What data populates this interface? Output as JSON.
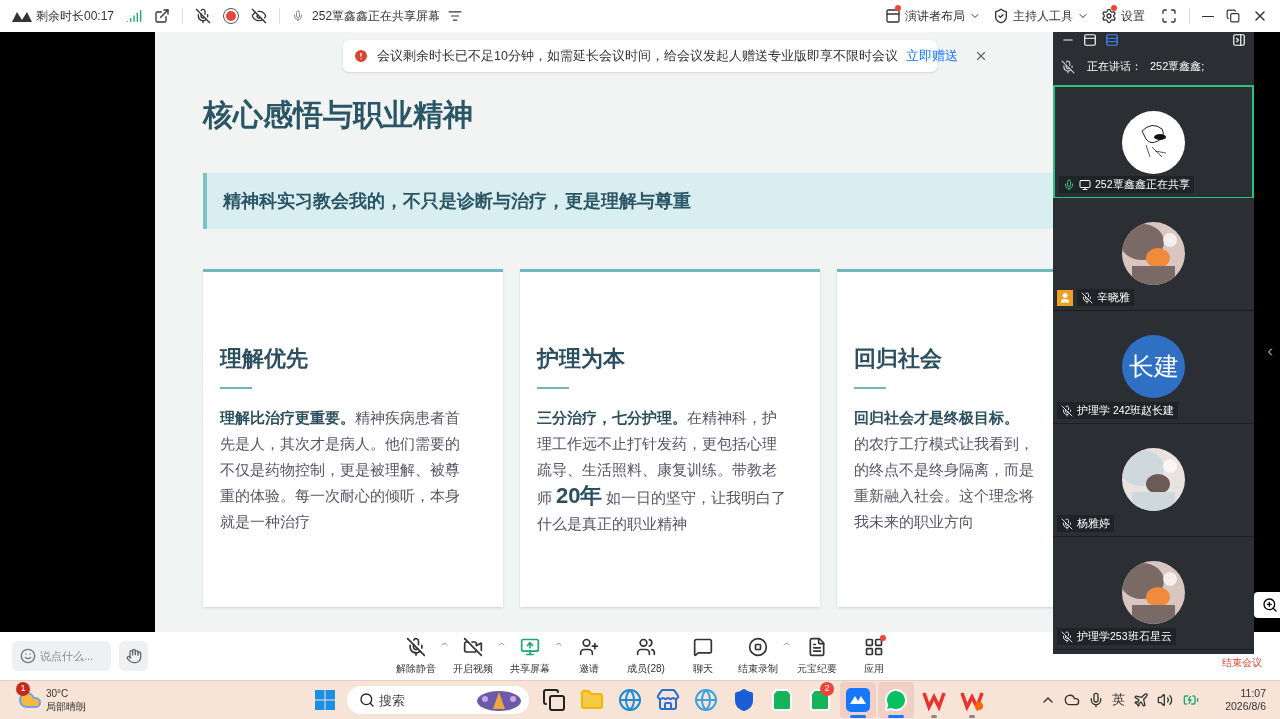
{
  "top_bar": {
    "remaining": "剩余时长00:17",
    "sharing_status": "252覃鑫鑫正在共享屏幕",
    "layout_button": "演讲者布局",
    "host_tools_button": "主持人工具",
    "settings_button": "设置"
  },
  "notice": {
    "message": "会议剩余时长已不足10分钟，如需延长会议时间，给会议发起人赠送专业版即享不限时会议",
    "link": "立即赠送"
  },
  "slide": {
    "title": "核心感悟与职业精神",
    "banner": "精神科实习教会我的，不只是诊断与治疗，更是**理解与尊重**",
    "cards": [
      {
        "heading": "理解优先",
        "lines": [
          [
            {
              "kind": "bold",
              "text": "理解比治疗更重要。"
            },
            {
              "kind": "plain",
              "text": "精神疾病患者首"
            }
          ],
          [
            {
              "kind": "plain",
              "text": "先是人，其次才是病人。他们需要的"
            }
          ],
          [
            {
              "kind": "plain",
              "text": "不仅是药物控制，更是被理解、被尊"
            }
          ],
          [
            {
              "kind": "plain",
              "text": "重的体验。每一次耐心的倾听，本身"
            }
          ],
          [
            {
              "kind": "plain",
              "text": "就是一种治疗"
            }
          ]
        ]
      },
      {
        "heading": "护理为本",
        "lines": [
          [
            {
              "kind": "bold",
              "text": "三分治疗，七分护理。"
            },
            {
              "kind": "plain",
              "text": "在精神科，护"
            }
          ],
          [
            {
              "kind": "plain",
              "text": "理工作远不止打针发药，更包括心理"
            }
          ],
          [
            {
              "kind": "plain",
              "text": "疏导、生活照料、康复训练。带教老"
            }
          ],
          [
            {
              "kind": "plain",
              "text": "师"
            },
            {
              "kind": "big",
              "text": "20年"
            },
            {
              "kind": "plain",
              "text": "如一日的坚守，让我明白了"
            }
          ],
          [
            {
              "kind": "plain",
              "text": "什么是真正的职业精神"
            }
          ]
        ]
      },
      {
        "heading": "回归社会",
        "lines": [
          [
            {
              "kind": "bold",
              "text": "回归社会才是终极目标。"
            }
          ],
          [
            {
              "kind": "plain",
              "text": "的农疗工疗模式让我看到，"
            }
          ],
          [
            {
              "kind": "plain",
              "text": "的终点不是终身隔离，而是"
            }
          ],
          [
            {
              "kind": "plain",
              "text": "重新融入社会。这个理念将"
            }
          ],
          [
            {
              "kind": "plain",
              "text": "我未来的职业方向"
            }
          ]
        ]
      }
    ]
  },
  "panel": {
    "speaking_label": "正在讲话：",
    "speaker": "252覃鑫鑫;",
    "participants": [
      {
        "name": "252覃鑫鑫正在共享",
        "selected": true,
        "muted": false,
        "sharing": true,
        "host": false,
        "avatar": {
          "kind": "sketch"
        }
      },
      {
        "name": "辛晓雅",
        "selected": false,
        "muted": true,
        "sharing": false,
        "host": true
      },
      {
        "name": "护理学 242班赵长建",
        "selected": false,
        "muted": true,
        "sharing": false,
        "host": false,
        "avatar": {
          "kind": "initials",
          "text": "长建"
        }
      },
      {
        "name": "杨雅婷",
        "selected": false,
        "muted": true,
        "sharing": false,
        "host": false
      },
      {
        "name": "护理学253班石星云",
        "selected": false,
        "muted": true,
        "sharing": false,
        "host": false
      }
    ]
  },
  "toolbar": {
    "chat_input": {
      "placeholder": "说点什么..."
    },
    "controls": [
      {
        "label": "解除静音",
        "kind": "mic",
        "menu": true,
        "badge": false
      },
      {
        "label": "开启视频",
        "kind": "video",
        "menu": true,
        "badge": false
      },
      {
        "label": "共享屏幕",
        "kind": "share",
        "menu": true,
        "badge": false
      },
      {
        "label": "邀请",
        "kind": "invite",
        "menu": false,
        "badge": false
      },
      {
        "label": "成员(28)",
        "kind": "members",
        "menu": false,
        "badge": false
      },
      {
        "label": "聊天",
        "kind": "chat",
        "menu": false,
        "badge": false
      },
      {
        "label": "结束录制",
        "kind": "record",
        "menu": true,
        "badge": false
      },
      {
        "label": "元宝纪要",
        "kind": "minutes",
        "menu": false,
        "badge": false
      },
      {
        "label": "应用",
        "kind": "apps",
        "menu": false,
        "badge": true
      }
    ],
    "end_button": "结束会议"
  },
  "taskbar": {
    "weather": {
      "badge": "1",
      "temp": "30°C",
      "desc": "局部晴朗"
    },
    "search": {
      "placeholder": "搜索"
    },
    "apps": [
      {
        "kind": "taskview",
        "selected": false,
        "running": false
      },
      {
        "kind": "files",
        "selected": false,
        "running": false
      },
      {
        "kind": "edge",
        "selected": false,
        "running": false
      },
      {
        "kind": "store",
        "selected": false,
        "running": false
      },
      {
        "kind": "edge-ai",
        "selected": false,
        "running": false
      },
      {
        "kind": "shield",
        "selected": false,
        "running": false
      },
      {
        "kind": "bag",
        "selected": false,
        "running": false
      },
      {
        "kind": "bag",
        "selected": false,
        "running": false,
        "badge": "2"
      },
      {
        "kind": "meeting",
        "selected": true,
        "running": true
      },
      {
        "kind": "wechat",
        "selected": true,
        "running": true
      },
      {
        "kind": "wps",
        "selected": false,
        "running": true
      },
      {
        "kind": "wps-video",
        "selected": false,
        "running": true
      }
    ],
    "ime": "英",
    "time": "11:07",
    "date": "2026/8/6"
  }
}
